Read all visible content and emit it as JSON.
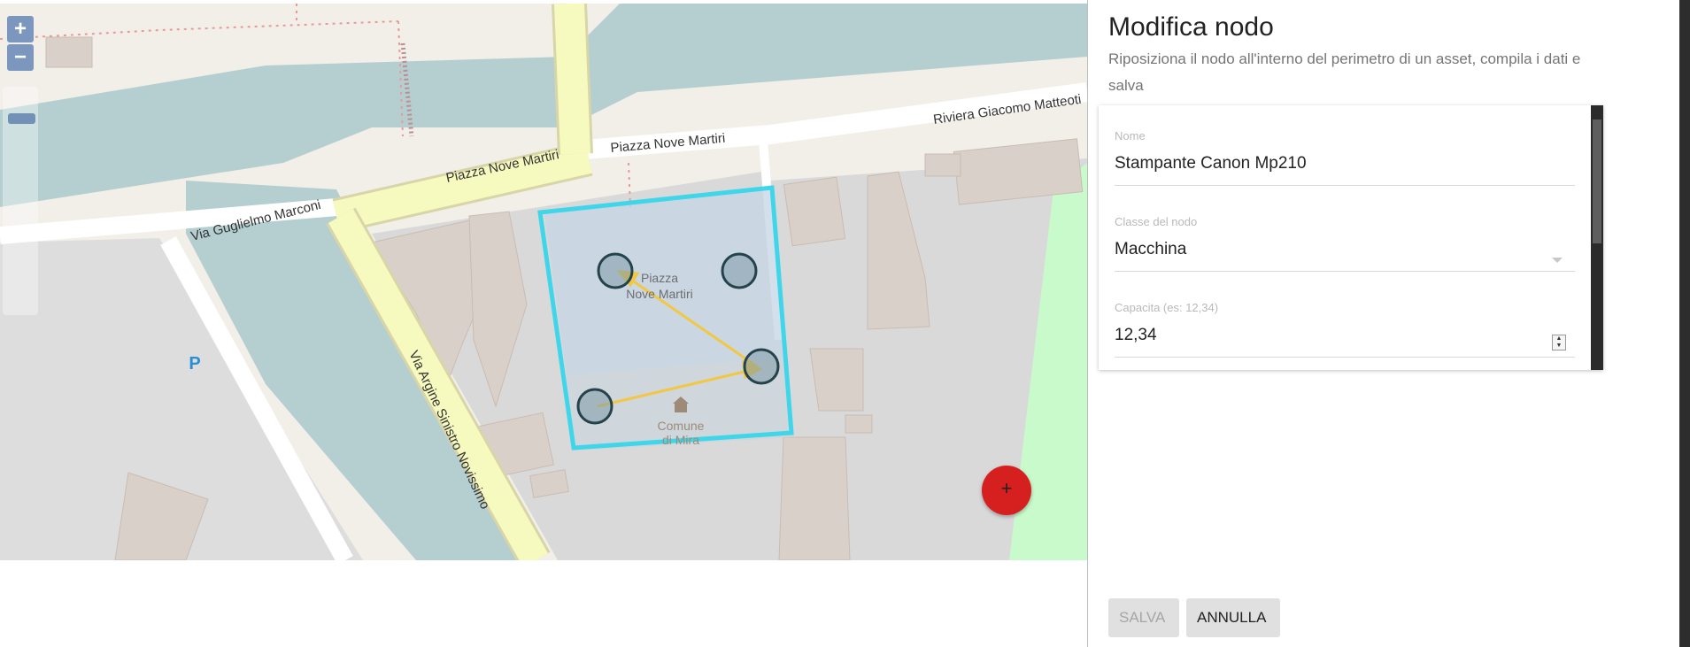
{
  "map": {
    "zoom_in_label": "+",
    "zoom_out_label": "−",
    "fab_label": "+",
    "street_labels": {
      "via_guglielmo_marconi": "Via Guglielmo Marconi",
      "piazza_nove_martiri_1": "Piazza Nove Martiri",
      "piazza_nove_martiri_2": "Piazza Nove Martiri",
      "riviera_giacomo_matteotti": "Riviera Giacomo Matteoti",
      "via_argine": "Via Argine Sinistro Novissimo"
    },
    "poi_labels": {
      "square_line1": "Piazza",
      "square_line2": "Nove Martiri",
      "comune_line1": "Comune",
      "comune_line2": "di Mira",
      "parking": "P"
    }
  },
  "panel": {
    "title": "Modifica nodo",
    "subtitle": "Riposiziona il nodo all'interno del perimetro di un asset, compila i dati e salva",
    "fields": {
      "nome": {
        "label": "Nome",
        "value": "Stampante Canon Mp210"
      },
      "classe": {
        "label": "Classe del nodo",
        "value": "Macchina"
      },
      "capacita": {
        "label": "Capacita (es: 12,34)",
        "value": "12,34"
      }
    },
    "buttons": {
      "save": "Salva",
      "cancel": "Annulla"
    }
  },
  "colors": {
    "asset_outline": "#3fd6ea",
    "node_fill": "#7f9aa7",
    "node_stroke": "#24434a",
    "edge_color": "#f2c744",
    "fab": "#d61f1f",
    "water": "#aad3df",
    "road_primary": "#f7fabf"
  }
}
